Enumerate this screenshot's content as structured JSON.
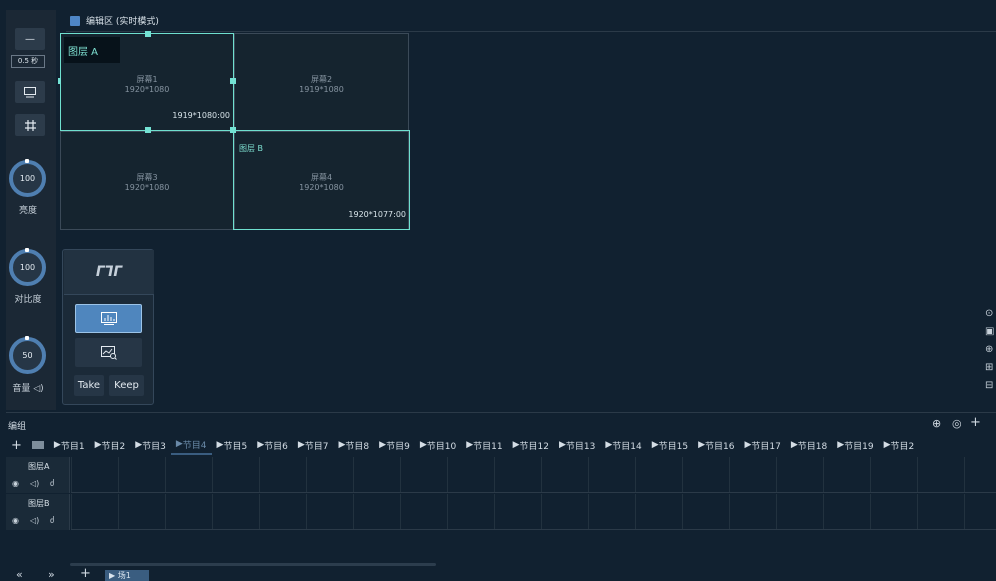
{
  "left_toolbar": {
    "minus_label": "—",
    "time_value": "0.5 秒",
    "monitor_icon": "monitor-icon",
    "grid_icon": "hash-icon",
    "brightness": {
      "value": "100",
      "label": "亮度"
    },
    "contrast": {
      "value": "100",
      "label": "对比度"
    },
    "volume": {
      "value": "50",
      "label": "音量 ◁)"
    }
  },
  "editor": {
    "title": "编辑区 (实时模式)",
    "screens": [
      {
        "name": "屏幕1",
        "res": "1920*1080"
      },
      {
        "name": "屏幕2",
        "res": "1919*1080"
      },
      {
        "name": "屏幕3",
        "res": "1920*1080"
      },
      {
        "name": "屏幕4",
        "res": "1920*1080"
      }
    ],
    "layers": [
      {
        "name": "图层 A",
        "size": "1919*1080:00"
      },
      {
        "name": "图层 B",
        "size": "1920*1077:00"
      }
    ]
  },
  "control_card": {
    "logo": "ᒥᒣᒥ",
    "take_label": "Take",
    "keep_label": "Keep"
  },
  "timeline": {
    "title": "编组",
    "add_label": "+",
    "programs": [
      "节目1",
      "节目2",
      "节目3",
      "节目4",
      "节目5",
      "节目6",
      "节目7",
      "节目8",
      "节目9",
      "节目10",
      "节目11",
      "节目12",
      "节目13",
      "节目14",
      "节目15",
      "节目16",
      "节目17",
      "节目18",
      "节目19",
      "节目2"
    ],
    "selected_program": "节目4",
    "tracks": [
      {
        "name": "图层A"
      },
      {
        "name": "图层B"
      }
    ],
    "bottom": {
      "first": "«",
      "last": "»",
      "add": "+",
      "scene_label": "▶ 场1"
    }
  },
  "colors": {
    "accent": "#6fe0cf",
    "primary_blue": "#4f7fb1",
    "background": "#112130",
    "active_indicator": "#26d04a"
  }
}
